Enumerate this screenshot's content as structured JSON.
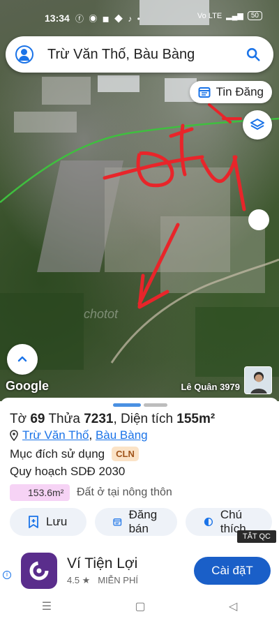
{
  "status_bar": {
    "time": "13:34",
    "app_icons": [
      "facebook-icon",
      "messenger-icon",
      "app-icon",
      "app-icon",
      "tiktok-icon"
    ],
    "network": "Vo LTE",
    "battery": "50"
  },
  "search": {
    "text": "Trừ Văn Thố, Bàu Bàng"
  },
  "map": {
    "tin_dang_label": "Tin Đăng",
    "google_label": "Google",
    "author_label": "Lê Quân 3979",
    "watermark": "chotot",
    "annotation_text": "Đất"
  },
  "parcel": {
    "sheet_prefix": "Tờ",
    "sheet_no": "69",
    "lot_prefix": "Thửa",
    "lot_no": "7231",
    "area_prefix": ", Diện tích",
    "area_value": "155m²",
    "location_part1": "Trừ Văn Thố",
    "location_sep": ", ",
    "location_part2": "Bàu Bàng",
    "purpose_label": "Mục đích sử dụng",
    "purpose_badge": "CLN",
    "plan_label": "Quy hoạch SDĐ 2030",
    "plan_area": "153.6m²",
    "plan_area_desc": "Đất ở tại nông thôn"
  },
  "actions": {
    "save": "Lưu",
    "sell": "Đăng bán",
    "note": "Chú thích"
  },
  "ad": {
    "close_label": "TẮT QC",
    "app_name": "Ví Tiện Lợi",
    "rating": "4.5 ★",
    "price": "MIỄN PHÍ",
    "install": "Cài đặT"
  },
  "colors": {
    "accent": "#1a73e8",
    "annotation": "#e8252a",
    "route": "#3fbf3f",
    "badge_bg": "#fbe3c7",
    "area_chip": "#f6d3f5"
  }
}
